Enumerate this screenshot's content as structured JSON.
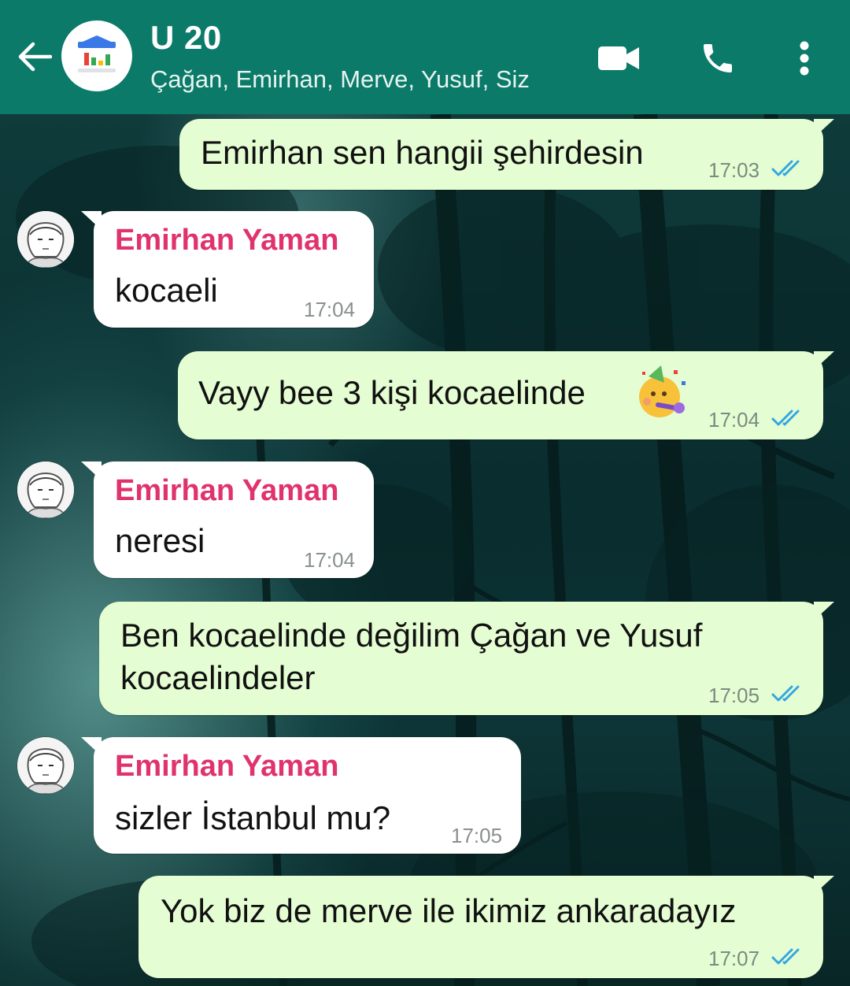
{
  "colors": {
    "header": "#0b7a68",
    "outgoing_bubble": "#e5fdd3",
    "incoming_bubble": "#ffffff",
    "sender_name": "#e0336e",
    "read_ticks": "#34a7e0"
  },
  "header": {
    "title": "U 20",
    "participants": "Çağan, Emirhan, Merve, Yusuf, Siz",
    "icons": [
      "back-arrow-icon",
      "group-avatar-icon",
      "video-call-icon",
      "voice-call-icon",
      "more-options-icon"
    ]
  },
  "messages": [
    {
      "direction": "out",
      "text": "Emirhan sen hangii şehirdesin",
      "time": "17:03",
      "status": "read"
    },
    {
      "direction": "in",
      "sender": "Emirhan Yaman",
      "text": "kocaeli",
      "time": "17:04"
    },
    {
      "direction": "out",
      "text": "Vayy bee 3 kişi kocaelinde",
      "emoji": "partying-face-emoji",
      "time": "17:04",
      "status": "read"
    },
    {
      "direction": "in",
      "sender": "Emirhan Yaman",
      "text": "neresi",
      "time": "17:04"
    },
    {
      "direction": "out",
      "text_line1": "Ben kocaelinde değilim Çağan ve Yusuf",
      "text_line2": "kocaelindeler",
      "time": "17:05",
      "status": "read"
    },
    {
      "direction": "in",
      "sender": "Emirhan Yaman",
      "text": "sizler İstanbul mu?",
      "time": "17:05"
    },
    {
      "direction": "out",
      "text": "Yok biz de merve ile ikimiz ankaradayız",
      "time": "17:07",
      "status": "read"
    }
  ]
}
